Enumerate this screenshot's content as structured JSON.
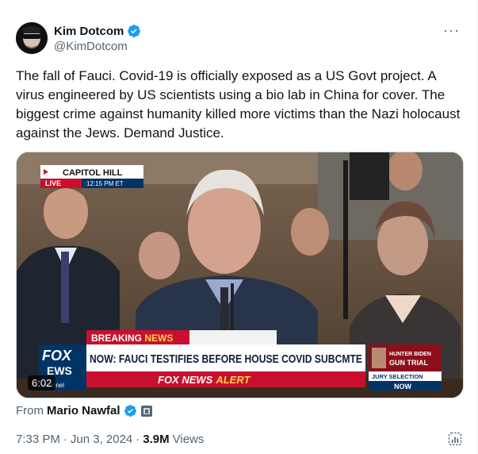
{
  "author": {
    "display_name": "Kim Dotcom",
    "handle": "@KimDotcom"
  },
  "tweet": {
    "text": "The fall of Fauci. Covid-19 is officially exposed as a US Govt project. A virus engineered by US scientists using a bio lab in China for cover. The biggest crime against humanity killed more victims than the Nazi holocaust against the Jews. Demand Justice."
  },
  "media": {
    "duration": "6:02",
    "bug_location": "CAPITOL HILL",
    "bug_live": "LIVE",
    "bug_time": "12:15 PM ET",
    "breaking_label": "BREAKING ",
    "breaking_news": "NEWS",
    "headline": "NOW: FAUCI TESTIFIES BEFORE HOUSE COVID SUBCMTE",
    "logo_fox": "FOX",
    "logo_news": "EWS",
    "logo_channel": "channel",
    "alert_fox_news": "FOX NEWS",
    "alert_word": "ALERT",
    "side_title_1": "HUNTER BIDEN",
    "side_title_2": "GUN TRIAL",
    "side_sub": "JURY SELECTION",
    "side_now": "NOW"
  },
  "source": {
    "label": "From",
    "name": "Mario Nawfal"
  },
  "meta": {
    "time": "7:33 PM",
    "sep1": "·",
    "date": "Jun 3, 2024",
    "sep2": "·",
    "views_count": "3.9M",
    "views_label": "Views"
  },
  "colors": {
    "verified_blue": "#1d9bf0",
    "fox_red": "#c8102e",
    "fox_blue": "#003366"
  }
}
